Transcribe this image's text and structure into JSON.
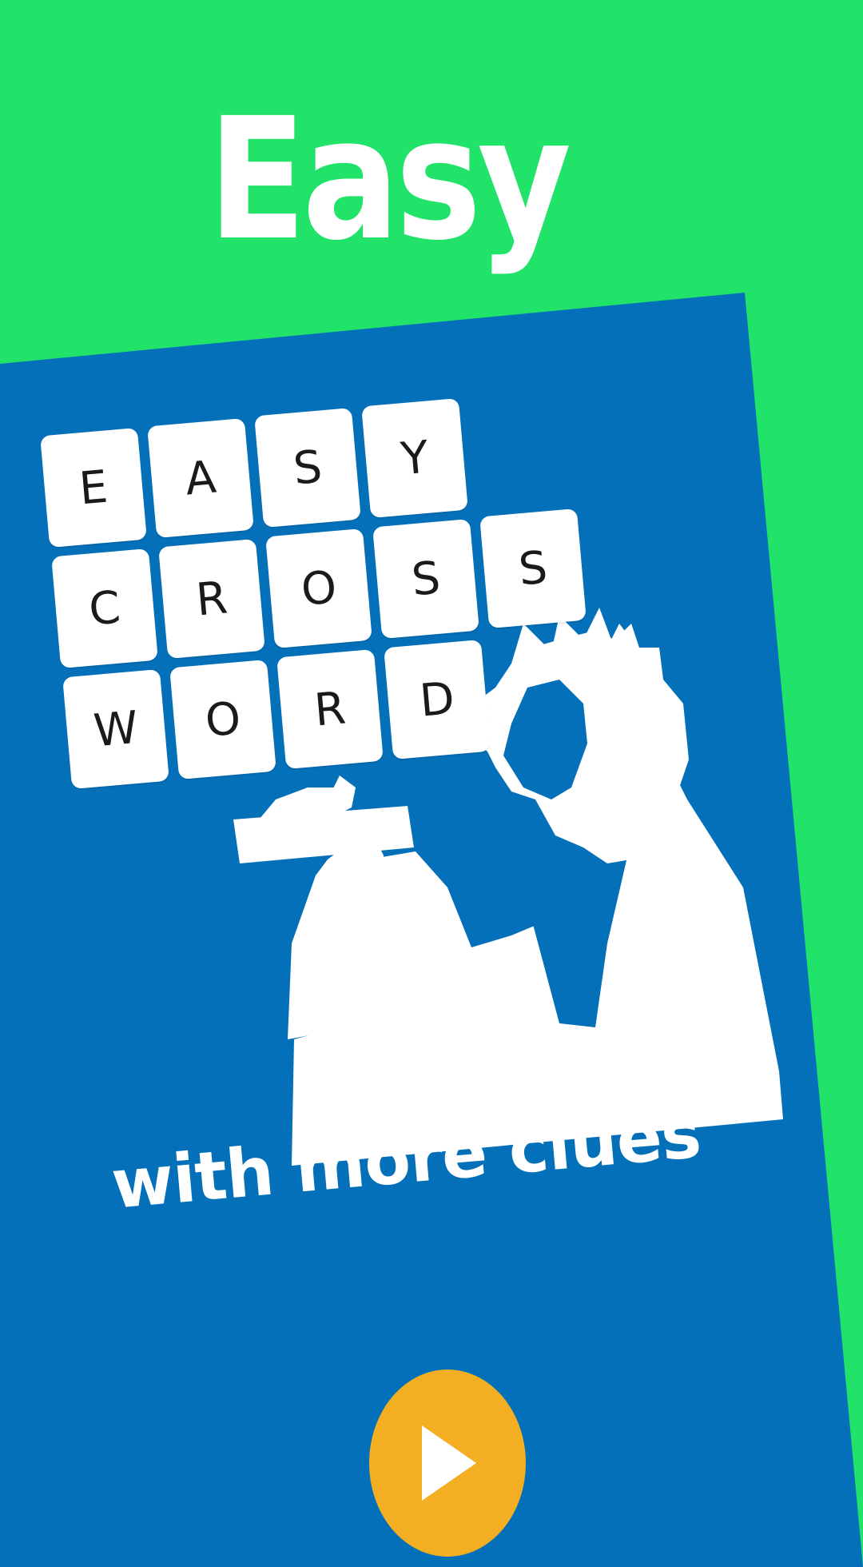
{
  "screen": {
    "title": "Easy",
    "subtitle": "with more clues",
    "play_icon": "play-icon"
  },
  "tiles": {
    "row1": [
      "E",
      "A",
      "S",
      "Y"
    ],
    "row2": [
      "C",
      "R",
      "O",
      "S",
      "S"
    ],
    "row3": [
      "W",
      "O",
      "R",
      "D"
    ]
  },
  "colors": {
    "background": "#22e36a",
    "panel": "#0470b9",
    "tile": "#ffffff",
    "play_button": "#f4ae22",
    "text": "#ffffff"
  }
}
